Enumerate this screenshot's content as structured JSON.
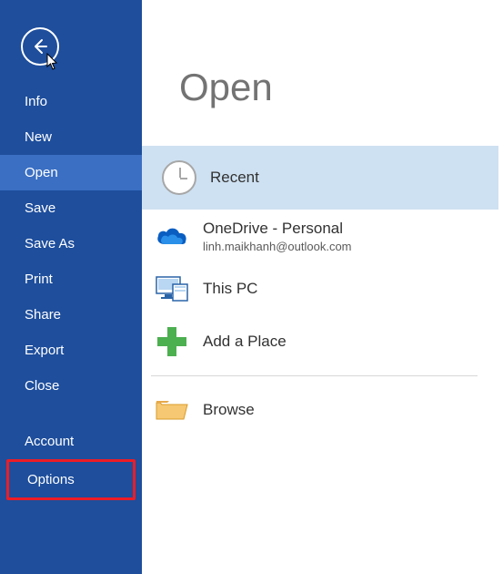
{
  "sidebar": {
    "items": [
      {
        "label": "Info"
      },
      {
        "label": "New"
      },
      {
        "label": "Open"
      },
      {
        "label": "Save"
      },
      {
        "label": "Save As"
      },
      {
        "label": "Print"
      },
      {
        "label": "Share"
      },
      {
        "label": "Export"
      },
      {
        "label": "Close"
      }
    ],
    "bottom_items": [
      {
        "label": "Account"
      },
      {
        "label": "Options"
      }
    ]
  },
  "main": {
    "title": "Open",
    "items": [
      {
        "label": "Recent"
      },
      {
        "label": "OneDrive - Personal",
        "sub": "linh.maikhanh@outlook.com"
      },
      {
        "label": "This PC"
      },
      {
        "label": "Add a Place"
      },
      {
        "label": "Browse"
      }
    ]
  }
}
